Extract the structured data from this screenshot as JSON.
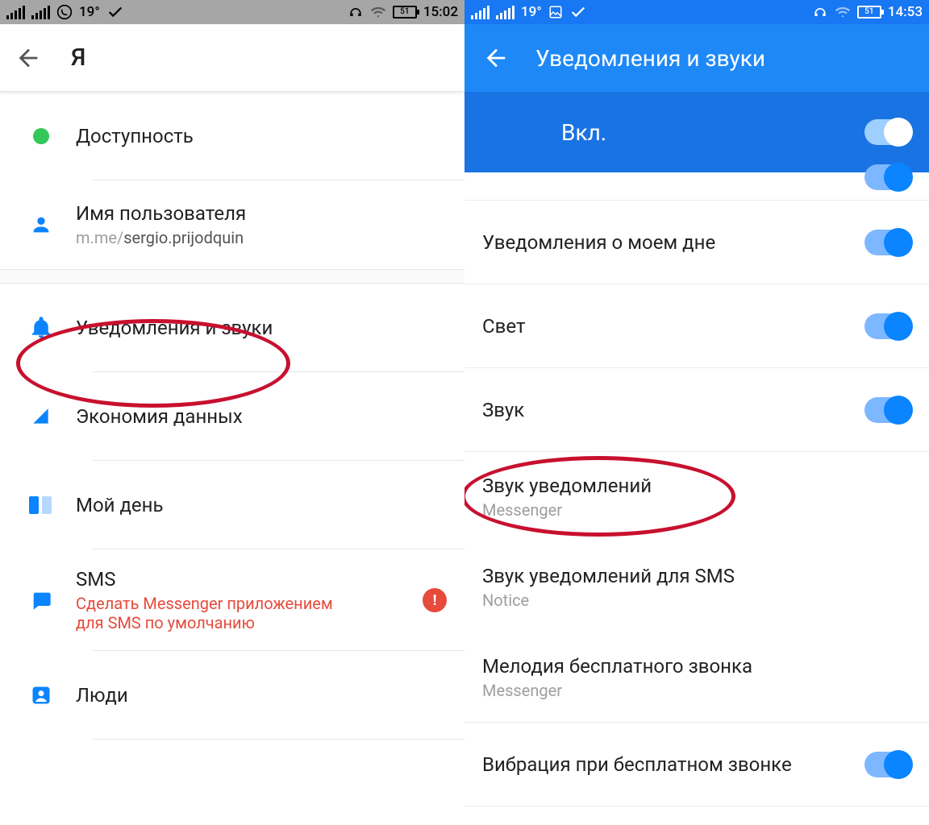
{
  "left": {
    "status": {
      "temp": "19°",
      "battery": "51",
      "time": "15:02"
    },
    "header": {
      "title": "Я"
    },
    "rows": {
      "availability": {
        "label": "Доступность"
      },
      "username": {
        "label": "Имя пользователя",
        "prefix": "m.me/",
        "value": "sergio.prijodquin"
      },
      "notifications": {
        "label": "Уведомления и звуки"
      },
      "data_saver": {
        "label": "Экономия данных"
      },
      "my_day": {
        "label": "Мой день"
      },
      "sms": {
        "label": "SMS",
        "subtitle": "Сделать Messenger приложением для SMS по умолчанию",
        "badge": "!"
      },
      "people": {
        "label": "Люди"
      }
    }
  },
  "right": {
    "status": {
      "temp": "19°",
      "battery": "51",
      "time": "14:53"
    },
    "header": {
      "title": "Уведомления и звуки",
      "master": "Вкл."
    },
    "rows": {
      "my_day_notif": {
        "label": "Уведомления о моем дне"
      },
      "light": {
        "label": "Свет"
      },
      "sound": {
        "label": "Звук"
      },
      "notif_sound": {
        "label": "Звук уведомлений",
        "subtitle": "Messenger"
      },
      "sms_sound": {
        "label": "Звук уведомлений для SMS",
        "subtitle": "Notice"
      },
      "ringtone": {
        "label": "Мелодия бесплатного звонка",
        "subtitle": "Messenger"
      },
      "call_vibrate": {
        "label": "Вибрация при бесплатном звонке"
      }
    }
  }
}
